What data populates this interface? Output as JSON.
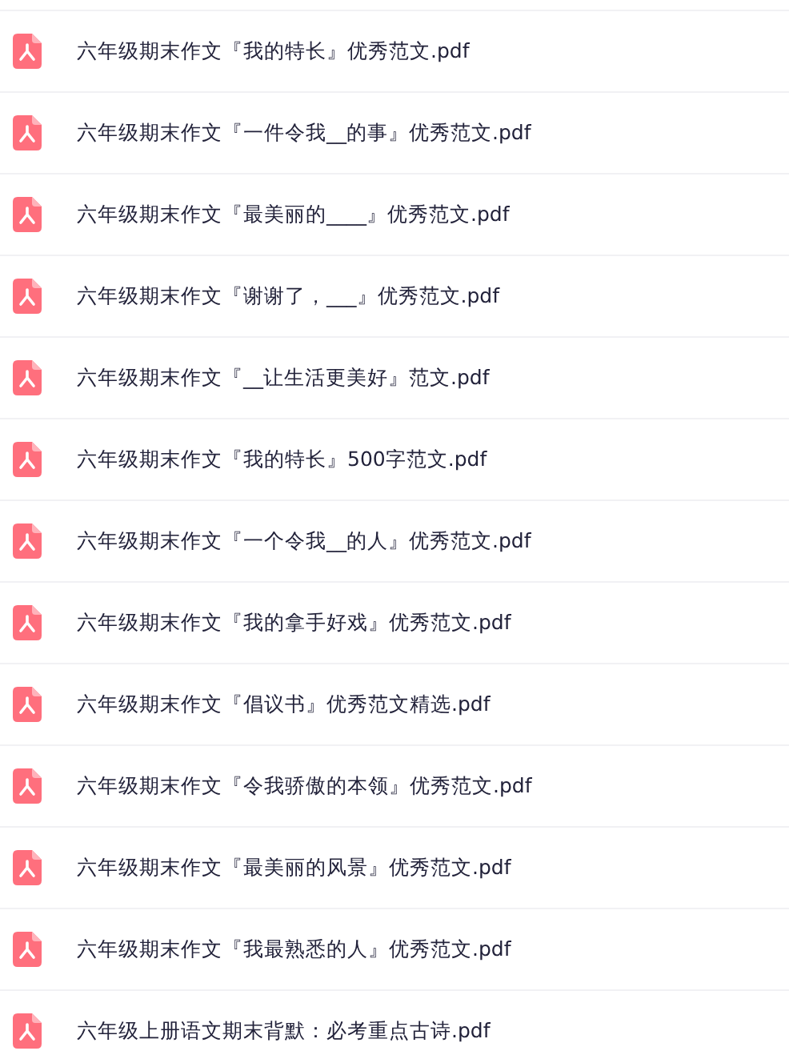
{
  "files": [
    {
      "name": "六年级期末作文『我的特长』优秀范文.pdf"
    },
    {
      "name": "六年级期末作文『一件令我__的事』优秀范文.pdf"
    },
    {
      "name": "六年级期末作文『最美丽的____』优秀范文.pdf"
    },
    {
      "name": "六年级期末作文『谢谢了，___』优秀范文.pdf"
    },
    {
      "name": "六年级期末作文『__让生活更美好』范文.pdf"
    },
    {
      "name": "六年级期末作文『我的特长』500字范文.pdf"
    },
    {
      "name": "六年级期末作文『一个令我__的人』优秀范文.pdf"
    },
    {
      "name": "六年级期末作文『我的拿手好戏』优秀范文.pdf"
    },
    {
      "name": "六年级期末作文『倡议书』优秀范文精选.pdf"
    },
    {
      "name": "六年级期末作文『令我骄傲的本领』优秀范文.pdf"
    },
    {
      "name": "六年级期末作文『最美丽的风景』优秀范文.pdf"
    },
    {
      "name": "六年级期末作文『我最熟悉的人』优秀范文.pdf"
    },
    {
      "name": "六年级上册语文期末背默：必考重点古诗.pdf"
    }
  ]
}
